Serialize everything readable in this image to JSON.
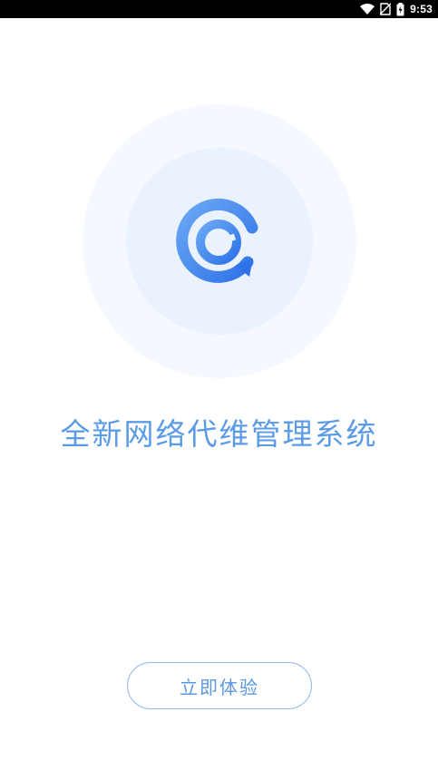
{
  "status_bar": {
    "time": "9:53",
    "icons": [
      "wifi-icon",
      "no-sim-icon",
      "battery-charging-icon"
    ]
  },
  "logo": {
    "icon": "app-logo-icon",
    "colors": {
      "primary": "#3f86ee",
      "light": "#6aa8f5",
      "circle_outer": "#f5f9ff",
      "circle_inner": "#eaf2fd"
    }
  },
  "headline": "全新网络代维管理系统",
  "start_button": {
    "label": "立即体验",
    "border_color": "#8fb9ec",
    "text_color": "#5b97e2"
  }
}
